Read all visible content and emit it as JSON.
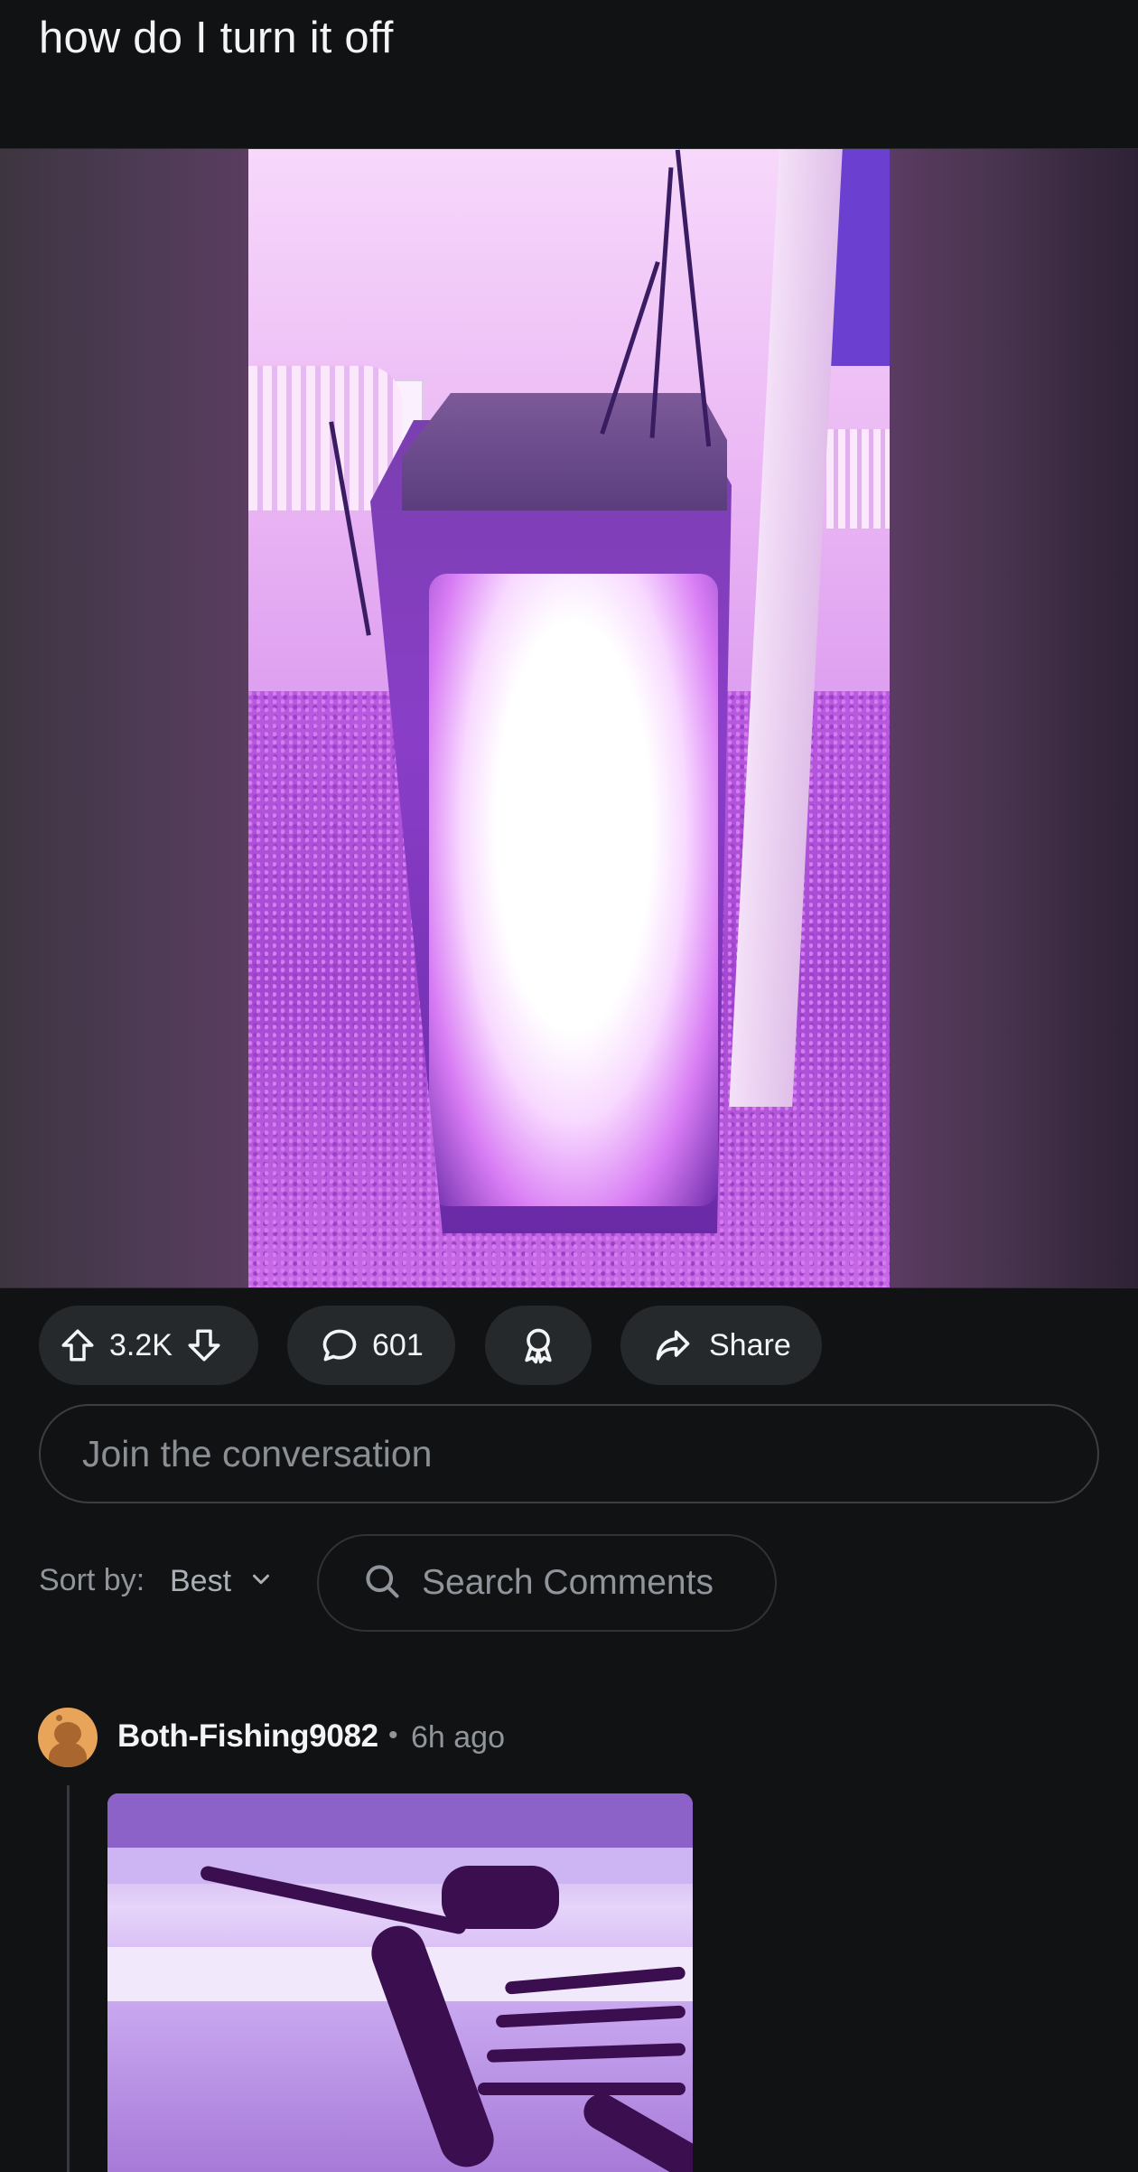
{
  "post": {
    "title": "how do I turn it off"
  },
  "actions": {
    "upvote_icon": "arrow-up-icon",
    "vote_count": "3.2K",
    "downvote_icon": "arrow-down-icon",
    "comment_icon": "speech-bubble-icon",
    "comment_count": "601",
    "award_icon": "award-icon",
    "share_icon": "share-arrow-icon",
    "share_label": "Share"
  },
  "composer": {
    "placeholder": "Join the conversation"
  },
  "sort": {
    "label": "Sort by:",
    "value": "Best",
    "search_placeholder": "Search Comments"
  },
  "comments": [
    {
      "author": "Both-Fishing9082",
      "separator": "•",
      "time": "6h ago"
    }
  ],
  "colors": {
    "background": "#111214",
    "pill": "#26292c",
    "text": "#f2f4f5",
    "muted": "#8f959a",
    "media_accent": "#c45ee4"
  }
}
